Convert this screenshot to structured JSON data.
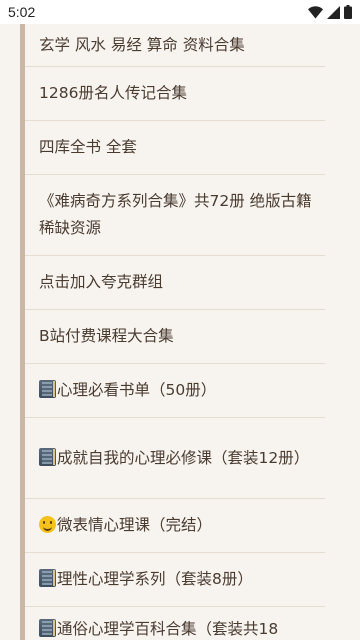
{
  "status_bar": {
    "time": "5:02",
    "icons": [
      "wifi-icon",
      "signal-icon",
      "battery-icon"
    ]
  },
  "list": {
    "items": [
      {
        "label": "玄学 风水 易经 算命 资料合集",
        "icon": ""
      },
      {
        "label": "1286册名人传记合集",
        "icon": ""
      },
      {
        "label": "四库全书 全套",
        "icon": ""
      },
      {
        "label": "《难病奇方系列合集》共72册 绝版古籍 稀缺资源",
        "icon": ""
      },
      {
        "label": "点击加入夸克群组",
        "icon": ""
      },
      {
        "label": "B站付费课程大合集",
        "icon": ""
      },
      {
        "label": "心理必看书单（50册）",
        "icon": "book-icon"
      },
      {
        "label": "成就自我的心理必修课（套装12册）",
        "icon": "book-icon"
      },
      {
        "label": "微表情心理课（完结）",
        "icon": "smile-icon"
      },
      {
        "label": "理性心理学系列（套装8册）",
        "icon": "book-icon"
      },
      {
        "label": "通俗心理学百科合集（套装共18",
        "icon": "book-icon"
      }
    ]
  },
  "colors": {
    "background": "#f7f4ef",
    "text": "#4a3b30",
    "quote_bar": "#c9b8a6",
    "divider": "#e6ddd2"
  }
}
